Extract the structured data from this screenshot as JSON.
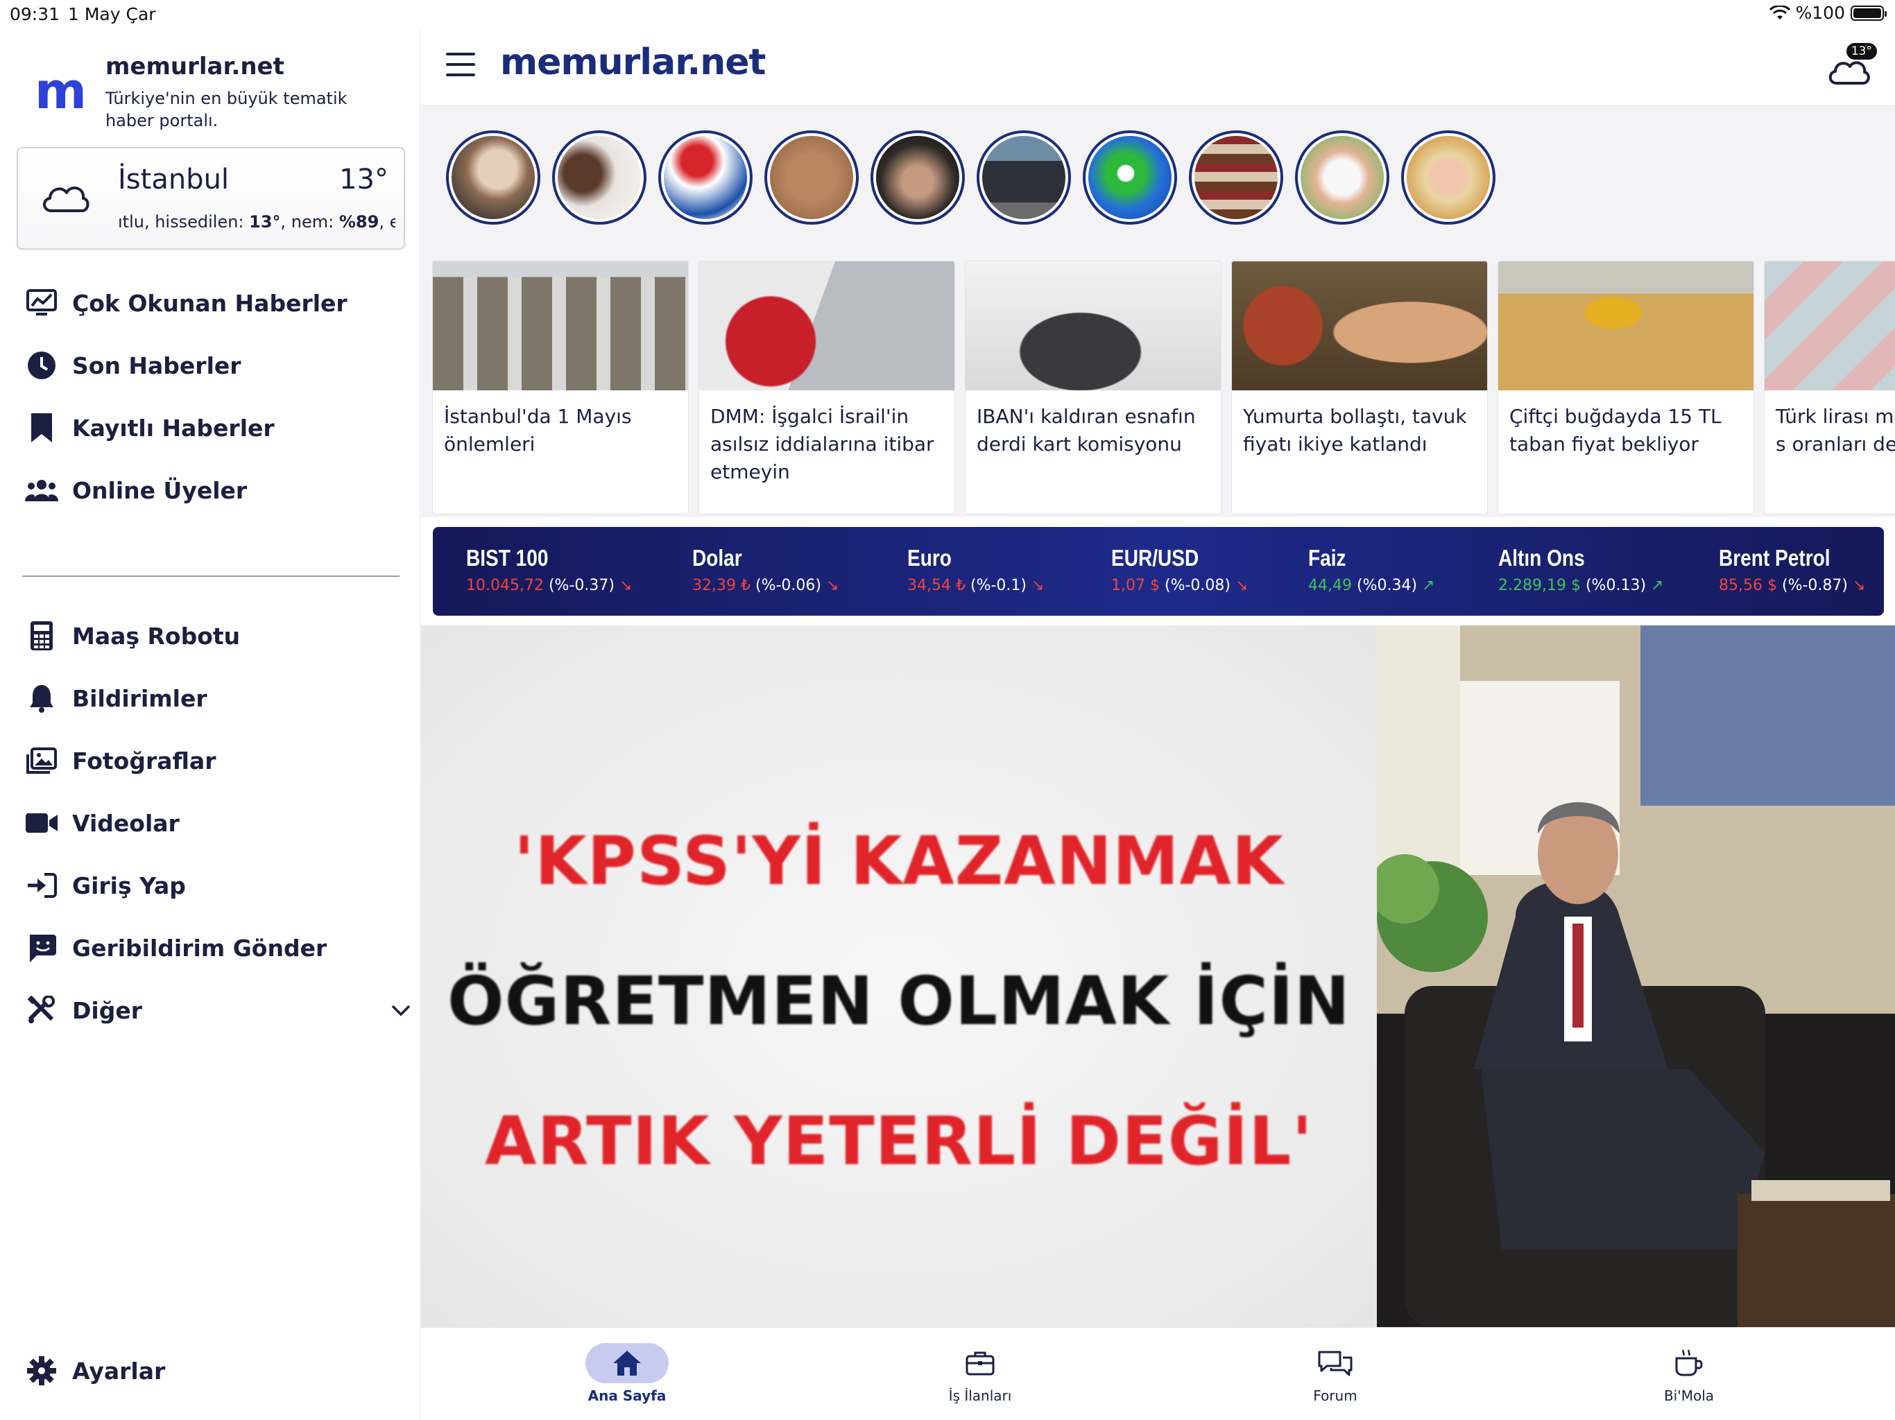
{
  "status_bar": {
    "time": "09:31",
    "date": "1 May Çar",
    "battery": "%100"
  },
  "sidebar": {
    "brand_name": "memurlar.net",
    "tagline": "Türkiye'nin en büyük tematik haber portalı.",
    "weather": {
      "city": "İstanbul",
      "temp": "13°",
      "detail_prefix": "ıtlu, hissedilen: ",
      "feels_like": "13°",
      "humidity_label": ", nem: ",
      "humidity": "%89",
      "detail_suffix": ", en"
    },
    "menu_primary": [
      {
        "label": "Çok Okunan Haberler",
        "icon": "trending-chart-icon"
      },
      {
        "label": "Son Haberler",
        "icon": "clock-icon"
      },
      {
        "label": "Kayıtlı Haberler",
        "icon": "bookmark-icon"
      },
      {
        "label": "Online Üyeler",
        "icon": "users-icon"
      }
    ],
    "menu_secondary": [
      {
        "label": "Maaş Robotu",
        "icon": "calculator-icon"
      },
      {
        "label": "Bildirimler",
        "icon": "bell-icon"
      },
      {
        "label": "Fotoğraflar",
        "icon": "photos-icon"
      },
      {
        "label": "Videolar",
        "icon": "video-icon"
      },
      {
        "label": "Giriş Yap",
        "icon": "login-icon"
      },
      {
        "label": "Geribildirim Gönder",
        "icon": "feedback-icon"
      },
      {
        "label": "Diğer",
        "icon": "tools-icon"
      }
    ],
    "settings_label": "Ayarlar"
  },
  "header": {
    "logo": "memurlar.net",
    "weather_badge": "13°"
  },
  "news": [
    {
      "title": "İstanbul'da 1 Mayıs önlemleri"
    },
    {
      "title": "DMM: İşgalci İsrail'in asılsız iddialarına itibar etmeyin"
    },
    {
      "title": "IBAN'ı kaldıran esnafın derdi kart komisyonu"
    },
    {
      "title": "Yumurta bollaştı, tavuk fiyatı ikiye katlandı"
    },
    {
      "title": "Çiftçi buğdayda 15 TL taban fiyat bekliyor"
    },
    {
      "title": "Türk lirası m uygulanan s oranları değ"
    }
  ],
  "ticker": [
    {
      "name": "BIST 100",
      "value": "10.045,72",
      "change": "(%-0.37)",
      "direction": "down"
    },
    {
      "name": "Dolar",
      "value": "32,39 ₺",
      "change": "(%-0.06)",
      "direction": "down"
    },
    {
      "name": "Euro",
      "value": "34,54 ₺",
      "change": "(%-0.1)",
      "direction": "down"
    },
    {
      "name": "EUR/USD",
      "value": "1,07 $",
      "change": "(%-0.08)",
      "direction": "down"
    },
    {
      "name": "Faiz",
      "value": "44,49",
      "change": "(%0.34)",
      "direction": "up"
    },
    {
      "name": "Altın Ons",
      "value": "2.289,19 $",
      "change": "(%0.13)",
      "direction": "up"
    },
    {
      "name": "Brent Petrol",
      "value": "85,56 $",
      "change": "(%-0.87)",
      "direction": "down"
    }
  ],
  "hero": {
    "line1": "'KPSS'Yİ KAZANMAK",
    "line2": "ÖĞRETMEN OLMAK İÇİN",
    "line3": "ARTIK YETERLİ DEĞİL'"
  },
  "tabs": [
    {
      "label": "Ana Sayfa",
      "icon": "home-icon",
      "active": true
    },
    {
      "label": "İş İlanları",
      "icon": "briefcase-icon",
      "active": false
    },
    {
      "label": "Forum",
      "icon": "chat-bubbles-icon",
      "active": false
    },
    {
      "label": "Bi'Mola",
      "icon": "coffee-cup-icon",
      "active": false
    }
  ],
  "colors": {
    "brand_blue": "#2e41d8",
    "navy": "#1b2d7a",
    "down_red": "#f0453e",
    "up_green": "#41c45b"
  }
}
